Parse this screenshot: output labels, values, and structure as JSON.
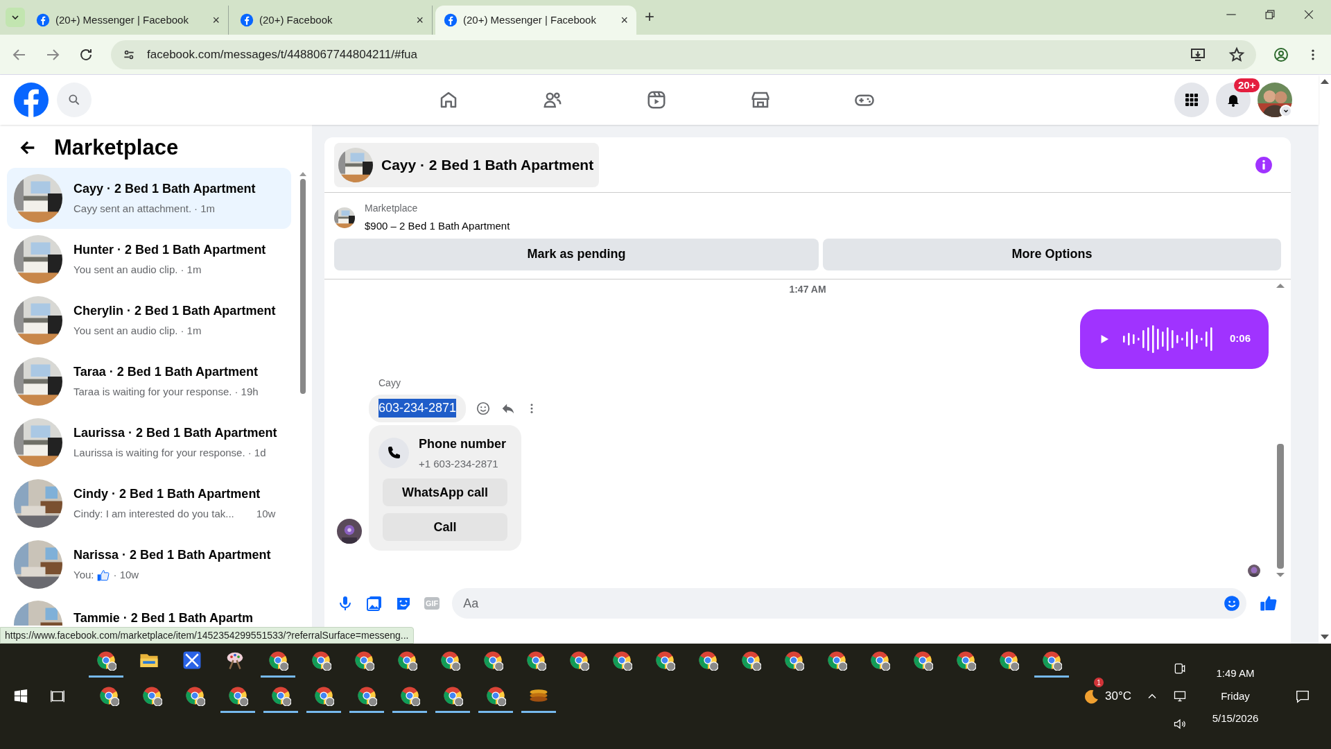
{
  "browser": {
    "tabs": [
      {
        "title": "(20+) Messenger | Facebook",
        "close": "×",
        "selected": false
      },
      {
        "title": "(20+) Facebook",
        "close": "×",
        "selected": false
      },
      {
        "title": "(20+) Messenger | Facebook",
        "close": "×",
        "selected": true
      }
    ],
    "new_tab": "+",
    "url": "facebook.com/messages/t/4488067744804211/#fua"
  },
  "header": {
    "notification_badge": "20+"
  },
  "sidebar": {
    "title": "Marketplace",
    "conversations": [
      {
        "title": "Cayy · 2 Bed 1 Bath Apartment",
        "kind": "text",
        "preview": "Cayy sent an attachment.",
        "time": "· 1m",
        "selected": true
      },
      {
        "title": "Hunter · 2 Bed 1 Bath Apartment",
        "kind": "text",
        "preview": "You sent an audio clip.",
        "time": "· 1m",
        "selected": false
      },
      {
        "title": "Cherylin · 2 Bed 1 Bath Apartment",
        "kind": "text",
        "preview": "You sent an audio clip.",
        "time": "· 1m",
        "selected": false
      },
      {
        "title": "Taraa · 2 Bed 1 Bath Apartment",
        "kind": "text",
        "preview": "Taraa is waiting for your response.",
        "time": "· 19h",
        "selected": false
      },
      {
        "title": "Laurissa · 2 Bed 1 Bath Apartment",
        "kind": "text",
        "preview": "Laurissa is waiting for your response.",
        "time": "· 1d",
        "selected": false
      },
      {
        "title": "Cindy · 2 Bed 1 Bath Apartment",
        "kind": "text",
        "preview": "Cindy: I am interested do you tak...",
        "time": "10w",
        "selected": false
      },
      {
        "title": "Narissa · 2 Bed 1 Bath Apartment",
        "kind": "like",
        "preview": "You:",
        "time": "· 10w",
        "selected": false
      },
      {
        "title": "Tammie · 2 Bed 1 Bath Apartm",
        "kind": "cut",
        "selected": false
      }
    ]
  },
  "chat": {
    "title": "Cayy · 2 Bed 1 Bath Apartment",
    "listing": {
      "label": "Marketplace",
      "name": "$900 – 2 Bed 1 Bath Apartment"
    },
    "actions": [
      "Mark as pending",
      "More Options"
    ],
    "timestamp": "1:47 AM",
    "audio": {
      "duration": "0:06"
    },
    "sender": "Cayy",
    "message": {
      "text": "603-234-2871",
      "selected": true
    },
    "phone_card": {
      "title": "Phone number",
      "number": "+1 603-234-2871",
      "buttons": [
        "WhatsApp call",
        "Call"
      ]
    },
    "composer": {
      "gif_label": "GIF",
      "placeholder": "Aa"
    }
  },
  "status_url": "https://www.facebook.com/marketplace/item/1452354299551533/?referralSurface=messeng...",
  "taskbar": {
    "top_row": [
      {
        "kind": "chrome",
        "running": true
      },
      {
        "kind": "folder",
        "running": false
      },
      {
        "kind": "app",
        "running": false
      },
      {
        "kind": "paint",
        "running": false
      },
      {
        "kind": "chrome",
        "running": true
      },
      {
        "kind": "chrome",
        "running": false
      },
      {
        "kind": "chrome",
        "running": false
      },
      {
        "kind": "chrome",
        "running": false
      },
      {
        "kind": "chrome",
        "running": false
      },
      {
        "kind": "chrome",
        "running": false
      },
      {
        "kind": "chrome",
        "running": false
      },
      {
        "kind": "chrome",
        "running": false
      },
      {
        "kind": "chrome",
        "running": false
      },
      {
        "kind": "chrome",
        "running": false
      },
      {
        "kind": "chrome",
        "running": false
      },
      {
        "kind": "chrome",
        "running": false
      },
      {
        "kind": "chrome",
        "running": false
      },
      {
        "kind": "chrome",
        "running": false
      },
      {
        "kind": "chrome",
        "running": false
      },
      {
        "kind": "chrome",
        "running": false
      },
      {
        "kind": "chrome",
        "running": false
      },
      {
        "kind": "chrome",
        "running": false
      },
      {
        "kind": "chrome",
        "running": true
      }
    ],
    "bottom_row": [
      {
        "kind": "chrome",
        "running": false
      },
      {
        "kind": "chrome",
        "running": false
      },
      {
        "kind": "chrome",
        "running": false
      },
      {
        "kind": "chrome",
        "running": true
      },
      {
        "kind": "chrome",
        "running": true
      },
      {
        "kind": "chrome",
        "running": true
      },
      {
        "kind": "chrome",
        "running": true
      },
      {
        "kind": "chrome",
        "running": true
      },
      {
        "kind": "chrome",
        "running": true
      },
      {
        "kind": "chrome",
        "running": true
      },
      {
        "kind": "coil",
        "running": true
      }
    ],
    "weather_badge": "1",
    "temperature": "30°C",
    "time": "1:49 AM",
    "day": "Friday",
    "date": "5/15/2026"
  }
}
